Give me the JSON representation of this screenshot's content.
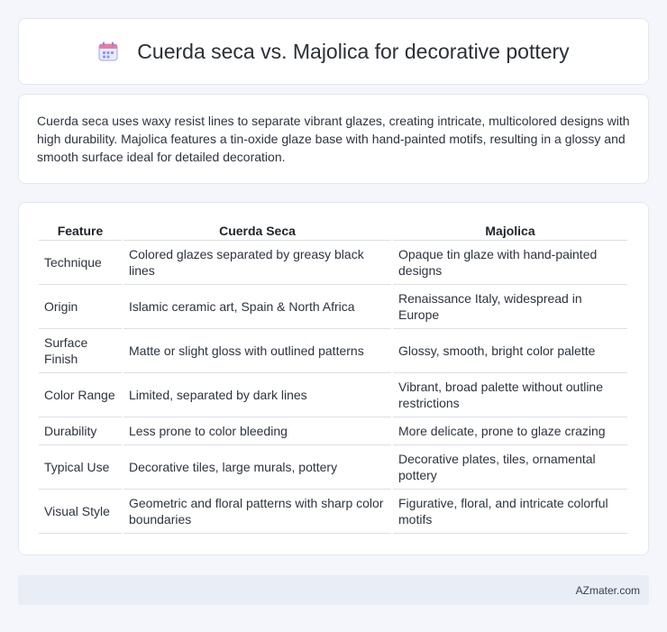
{
  "header": {
    "icon": "calendar-icon",
    "title": "Cuerda seca vs. Majolica for decorative pottery"
  },
  "intro": {
    "text": "Cuerda seca uses waxy resist lines to separate vibrant glazes, creating intricate, multicolored designs with high durability. Majolica features a tin-oxide glaze base with hand-painted motifs, resulting in a glossy and smooth surface ideal for detailed decoration."
  },
  "table": {
    "headers": [
      "Feature",
      "Cuerda Seca",
      "Majolica"
    ],
    "rows": [
      [
        "Technique",
        "Colored glazes separated by greasy black lines",
        "Opaque tin glaze with hand-painted designs"
      ],
      [
        "Origin",
        "Islamic ceramic art, Spain & North Africa",
        "Renaissance Italy, widespread in Europe"
      ],
      [
        "Surface Finish",
        "Matte or slight gloss with outlined patterns",
        "Glossy, smooth, bright color palette"
      ],
      [
        "Color Range",
        "Limited, separated by dark lines",
        "Vibrant, broad palette without outline restrictions"
      ],
      [
        "Durability",
        "Less prone to color bleeding",
        "More delicate, prone to glaze crazing"
      ],
      [
        "Typical Use",
        "Decorative tiles, large murals, pottery",
        "Decorative plates, tiles, ornamental pottery"
      ],
      [
        "Visual Style",
        "Geometric and floral patterns with sharp color boundaries",
        "Figurative, floral, and intricate colorful motifs"
      ]
    ]
  },
  "footer": {
    "brand": "AZmater.com"
  },
  "colors": {
    "background": "#f4f6fb",
    "footer_bg": "#e9edf6",
    "icon_accent": "#7b8cf0"
  }
}
